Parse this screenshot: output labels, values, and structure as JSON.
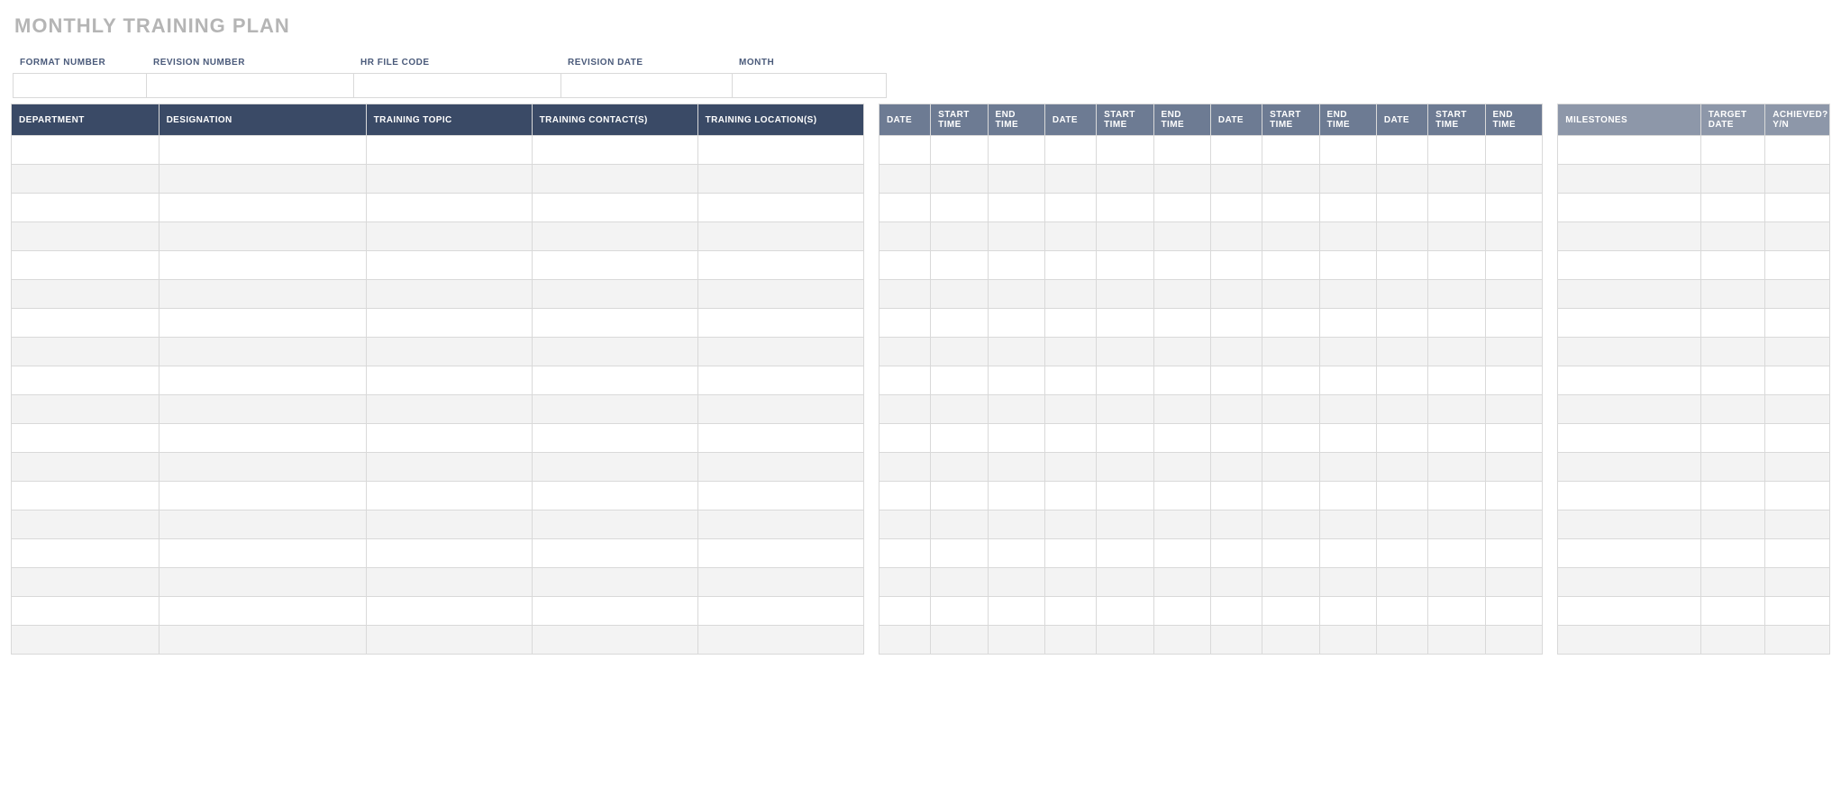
{
  "title": "MONTHLY TRAINING PLAN",
  "meta": {
    "labels": {
      "format_number": "FORMAT NUMBER",
      "revision_number": "REVISION NUMBER",
      "hr_file_code": "HR FILE CODE",
      "revision_date": "REVISION DATE",
      "month": "MONTH"
    },
    "values": {
      "format_number": "",
      "revision_number": "",
      "hr_file_code": "",
      "revision_date": "",
      "month": ""
    },
    "widths": {
      "format_number": 148,
      "revision_number": 230,
      "hr_file_code": 230,
      "revision_date": 190,
      "month": 172
    }
  },
  "headers": {
    "department": "DEPARTMENT",
    "designation": "DESIGNATION",
    "training_topic": "TRAINING TOPIC",
    "training_contacts": "TRAINING CONTACT(S)",
    "training_locations": "TRAINING LOCATION(S)",
    "date": "DATE",
    "start_time": "START TIME",
    "end_time": "END TIME",
    "milestones": "MILESTONES",
    "target_date": "TARGET DATE",
    "achieved": "ACHIEVED? Y/N"
  },
  "schedule_blocks": 4,
  "row_count": 18,
  "rows": []
}
